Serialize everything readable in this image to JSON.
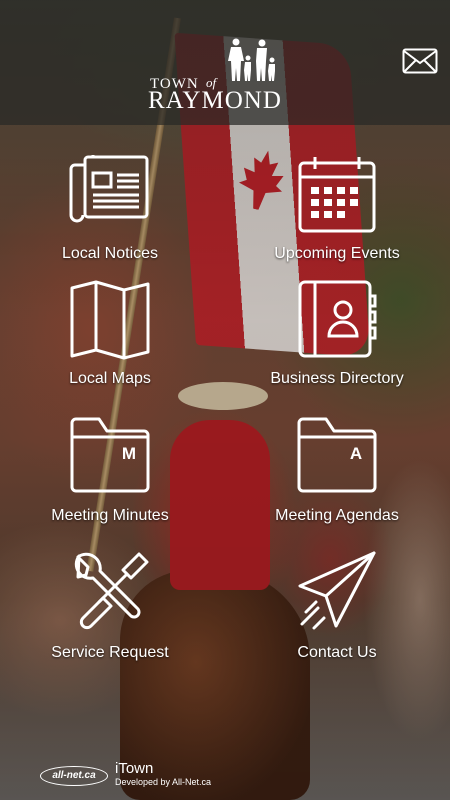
{
  "header": {
    "logo_town": "TOWN",
    "logo_of": "of",
    "logo_name": "RAYMOND"
  },
  "icons": {
    "mail": "mail-icon"
  },
  "tiles": [
    {
      "label": "Local Notices",
      "icon": "newspaper-icon"
    },
    {
      "label": "Upcoming Events",
      "icon": "calendar-icon"
    },
    {
      "label": "Local Maps",
      "icon": "map-icon"
    },
    {
      "label": "Business Directory",
      "icon": "contact-book-icon"
    },
    {
      "label": "Meeting Minutes",
      "icon": "folder-m-icon",
      "letter": "M"
    },
    {
      "label": "Meeting Agendas",
      "icon": "folder-a-icon",
      "letter": "A"
    },
    {
      "label": "Service Request",
      "icon": "wrench-screwdriver-icon"
    },
    {
      "label": "Contact Us",
      "icon": "paper-plane-icon"
    }
  ],
  "footer": {
    "badge": "all-net.ca",
    "brand": "iTown",
    "developer": "Developed by All-Net.ca"
  }
}
